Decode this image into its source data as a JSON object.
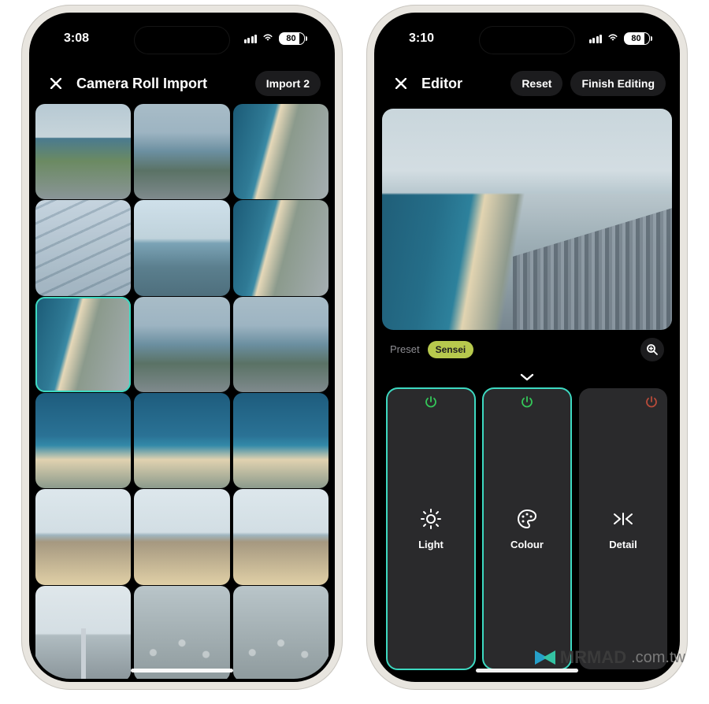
{
  "status": {
    "time_left": "3:08",
    "time_right": "3:10",
    "battery": "80"
  },
  "left": {
    "title": "Camera Roll Import",
    "import_button": "Import 2"
  },
  "right": {
    "title": "Editor",
    "reset_button": "Reset",
    "finish_button": "Finish Editing",
    "preset_label": "Preset",
    "preset_value": "Sensei",
    "tools": {
      "light": "Light",
      "colour": "Colour",
      "detail": "Detail"
    }
  },
  "watermark": {
    "brand": "MRMAD",
    "domain": ".com.tw"
  }
}
